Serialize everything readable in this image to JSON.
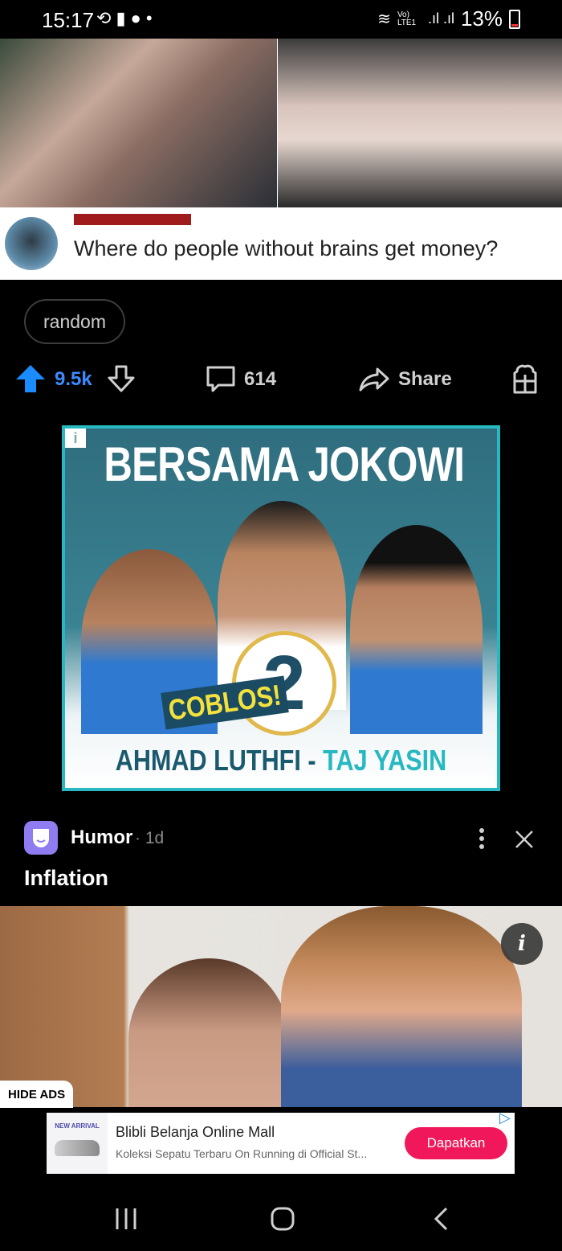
{
  "status_bar": {
    "time": "15:17",
    "left_icons": [
      "sync-icon",
      "alert-icon",
      "chat-icon",
      "dot"
    ],
    "network_label": "Vo) LTE1",
    "battery": "13%"
  },
  "post1": {
    "caption": "Where do people without brains get money?",
    "tag": "random",
    "upvotes": "9.5k",
    "comments": "614",
    "share_label": "Share"
  },
  "ad_banner": {
    "info_label": "i",
    "headline": "BERSAMA JOKOWI",
    "ballot_number": "2",
    "vote_call": "COBLOS!",
    "candidate_a": "AHMAD LUTHFI -",
    "candidate_b": "TAJ YASIN",
    "colors": {
      "border": "#27b8c1",
      "accent": "#f4e23c"
    }
  },
  "post2": {
    "community": "Humor",
    "age": "· 1d",
    "title": "Inflation",
    "info_label": "i"
  },
  "hide_ads_label": "HIDE ADS",
  "bottom_ad": {
    "thumb_label": "NEW ARRIVAL",
    "title": "Blibli Belanja Online Mall",
    "description": "Koleksi Sepatu Terbaru On Running di Official St...",
    "cta": "Dapatkan",
    "cta_color": "#f0185a"
  }
}
